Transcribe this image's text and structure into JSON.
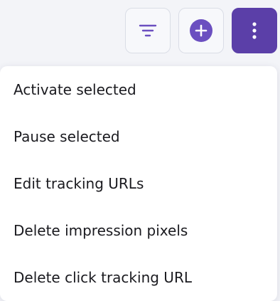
{
  "toolbar": {
    "filter_icon": "filter-lines-icon",
    "add_icon": "plus-circle-icon",
    "more_icon": "vertical-ellipsis-icon",
    "accent_color": "#5b3fa8",
    "icon_color": "#6b4fc0"
  },
  "menu": {
    "items": [
      {
        "label": "Activate selected"
      },
      {
        "label": "Pause selected"
      },
      {
        "label": "Edit tracking URLs"
      },
      {
        "label": "Delete impression pixels"
      },
      {
        "label": "Delete click tracking URL"
      }
    ]
  }
}
